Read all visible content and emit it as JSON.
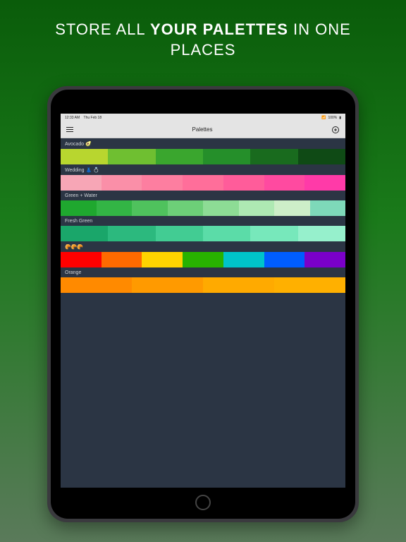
{
  "headline_pre": "STORE ALL ",
  "headline_bold": "YOUR PALETTES",
  "headline_post": " IN ONE PLACES",
  "status": {
    "time": "12:33 AM",
    "date": "Thu Feb 18",
    "battery": "100%"
  },
  "nav": {
    "title": "Palettes"
  },
  "palettes": [
    {
      "label": "Avocado 🥑",
      "colors": [
        "#b8d62f",
        "#6fbf31",
        "#3aa62e",
        "#258f2a",
        "#196b1e",
        "#0f4a15"
      ]
    },
    {
      "label": "Wedding 👗 💍",
      "colors": [
        "#f7a6b6",
        "#fa8fa8",
        "#fd7ea0",
        "#ff6e9a",
        "#ff5c9a",
        "#ff4aa0",
        "#ff3aa8"
      ]
    },
    {
      "label": "Green + Water",
      "colors": [
        "#1fa82f",
        "#33b545",
        "#4fc25d",
        "#6dcf78",
        "#8ddc95",
        "#aee9b3",
        "#cdeec8",
        "#7ed9b9"
      ]
    },
    {
      "label": "Fresh Green",
      "colors": [
        "#1aa66a",
        "#2cb97e",
        "#42cc93",
        "#5bdca8",
        "#77e8bb",
        "#96f0cc"
      ]
    },
    {
      "label": "🥐🥐🥐",
      "colors": [
        "#ff0000",
        "#ff6a00",
        "#ffd400",
        "#28b200",
        "#00c4c9",
        "#005dff",
        "#7a00c9"
      ]
    },
    {
      "label": "Orange",
      "colors": [
        "#ff8a00",
        "#ff9a00",
        "#ffaa00",
        "#ffb000"
      ]
    }
  ]
}
